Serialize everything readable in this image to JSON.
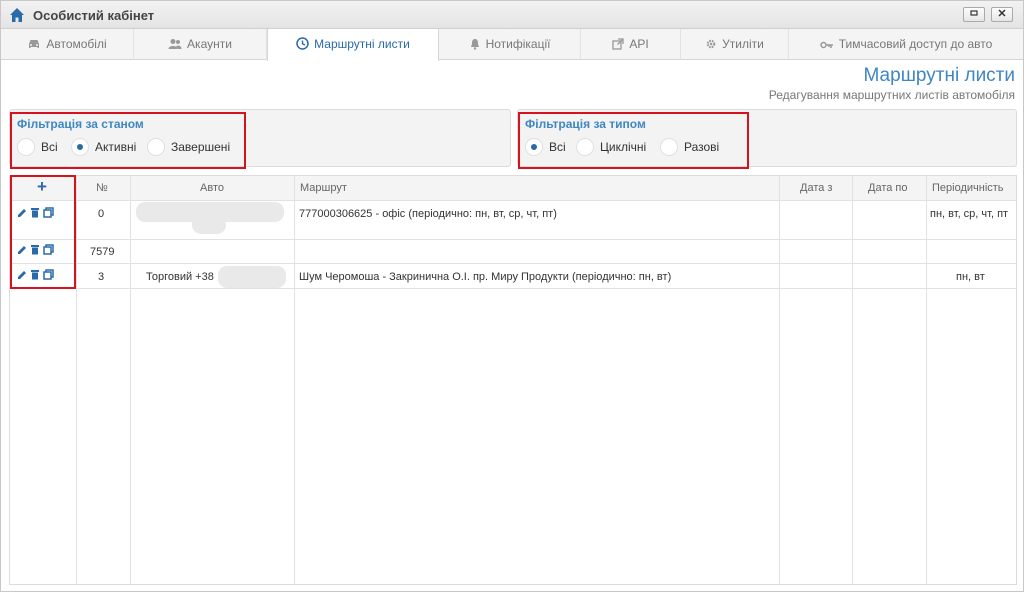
{
  "window": {
    "title": "Особистий кабінет"
  },
  "tabs": [
    {
      "label": "Автомобілі",
      "icon": "car-icon"
    },
    {
      "label": "Акаунти",
      "icon": "users-icon"
    },
    {
      "label": "Маршрутні листи",
      "icon": "clock-icon",
      "active": true
    },
    {
      "label": "Нотифікації",
      "icon": "bell-icon"
    },
    {
      "label": "API",
      "icon": "external-link-icon"
    },
    {
      "label": "Утиліти",
      "icon": "gear-icon"
    },
    {
      "label": "Тимчасовий доступ до авто",
      "icon": "key-icon"
    }
  ],
  "page": {
    "title": "Маршрутні листи",
    "subtitle": "Редагування маршрутних листів автомобіля"
  },
  "filter_state": {
    "title": "Фільтрація за станом",
    "options": [
      "Всі",
      "Активні",
      "Завершені"
    ],
    "selected": "Активні"
  },
  "filter_type": {
    "title": "Фільтрація за типом",
    "options": [
      "Всі",
      "Циклічні",
      "Разові"
    ],
    "selected": "Всі"
  },
  "table": {
    "add_label": "+",
    "columns": [
      "№",
      "Авто",
      "Маршрут",
      "Дата з",
      "Дата по",
      "Періодичність"
    ],
    "rows": [
      {
        "num": "0",
        "auto": "",
        "route": "777000306625 - офіс (періодично: пн, вт, ср, чт, пт)",
        "date_from": "",
        "date_to": "",
        "period": "пн, вт, ср, чт, пт"
      },
      {
        "num": "7579",
        "auto": "",
        "route": "",
        "date_from": "",
        "date_to": "",
        "period": ""
      },
      {
        "num": "3",
        "auto": "Торговий +38",
        "route": "Шум Черомоша - Закринична О.І. пр. Миру Продукти (періодично: пн, вт)",
        "date_from": "",
        "date_to": "",
        "period": "пн, вт"
      }
    ]
  },
  "colors": {
    "accent": "#3e86c4",
    "highlight": "#d6121f",
    "active_tab": "#2a6aa7"
  }
}
